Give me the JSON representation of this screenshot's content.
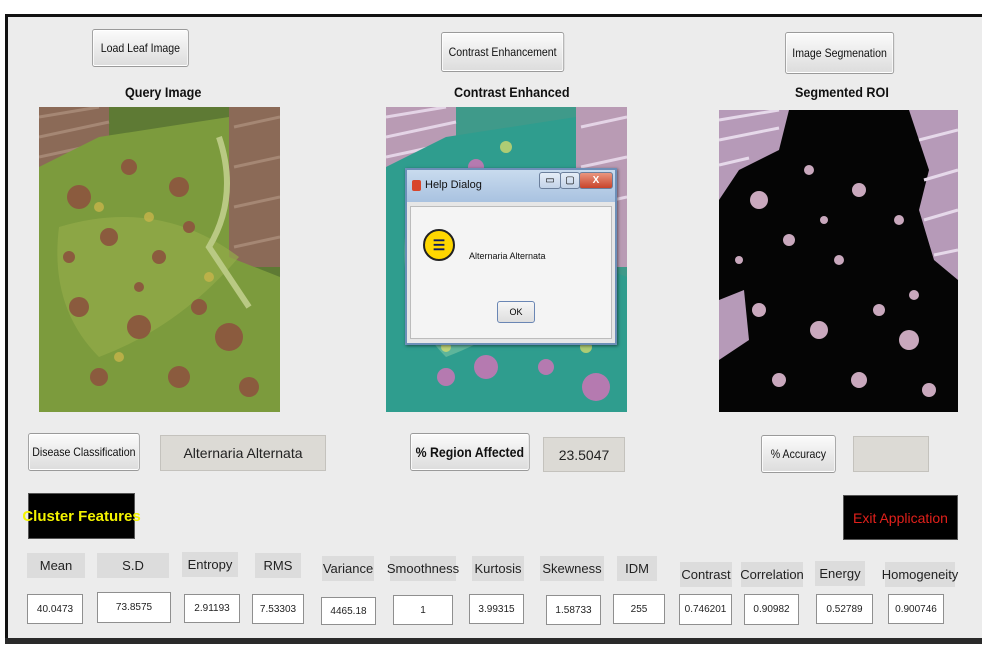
{
  "buttons": {
    "load_leaf": "Load Leaf Image",
    "contrast_enh": "Contrast Enhancement",
    "image_seg": "Image Segmenation",
    "disease_class": "Disease Classification",
    "region_affected": "% Region Affected",
    "accuracy": "% Accuracy",
    "cluster_features": "Cluster Features",
    "exit": "Exit Application"
  },
  "panels": {
    "query_title": "Query Image",
    "contrast_title": "Contrast Enhanced",
    "segmented_title": "Segmented ROI"
  },
  "results": {
    "disease_name": "Alternaria Alternata",
    "region_percent": "23.5047",
    "accuracy_value": ""
  },
  "features": {
    "labels": [
      "Mean",
      "S.D",
      "Entropy",
      "RMS",
      "Variance",
      "Smoothness",
      "Kurtosis",
      "Skewness",
      "IDM",
      "Contrast",
      "Correlation",
      "Energy",
      "Homogeneity"
    ],
    "values": [
      "40.0473",
      "73.8575",
      "2.91193",
      "7.53303",
      "4465.18",
      "1",
      "3.99315",
      "1.58733",
      "255",
      "0.746201",
      "0.90982",
      "0.52789",
      "0.900746"
    ]
  },
  "dialog": {
    "title": "Help Dialog",
    "message": "Alternaria Alternata",
    "ok": "OK",
    "minimize_glyph": "▭",
    "maximize_glyph": "▢",
    "close_glyph": "X"
  },
  "colors": {
    "cluster_text": "#f4f400",
    "exit_text": "#e0201b",
    "window_bg": "#ececec"
  }
}
